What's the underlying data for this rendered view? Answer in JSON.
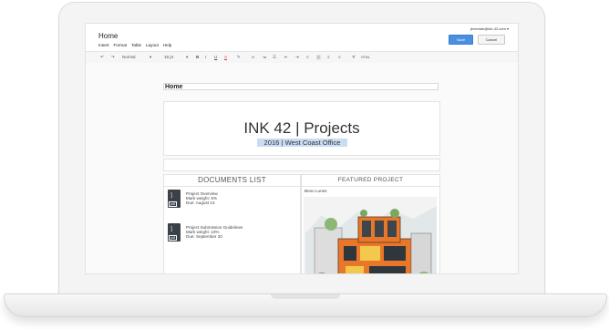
{
  "window": {
    "title": "Home",
    "user_email": "jeremiah@ink-42.com",
    "save_label": "Save",
    "cancel_label": "Cancel"
  },
  "menu": [
    "Insert",
    "Format",
    "Table",
    "Layout",
    "Help"
  ],
  "toolbar": {
    "style_value": "Normal",
    "size_value": "18 pt",
    "html_label": "HTML"
  },
  "document": {
    "heading": "Home",
    "title": "INK 42 | Projects",
    "subtitle": "2016 | West Coast Office",
    "documents_list_heading": "DOCUMENTS LIST",
    "featured_heading": "FEATURED PROJECT",
    "pdf_label": "pdf",
    "documents": [
      {
        "name": "Project Overview",
        "weight": "Mark weight: 5%",
        "due": "Due: August 13"
      },
      {
        "name": "Project Submission Guidelines",
        "weight": "Mark weight: 10%",
        "due": "Due: September 20"
      }
    ],
    "featured_author": "Beno Lunes"
  },
  "colors": {
    "accent": "#4a90e2",
    "highlight": "#c9dcf2",
    "building": "#e9772a"
  }
}
